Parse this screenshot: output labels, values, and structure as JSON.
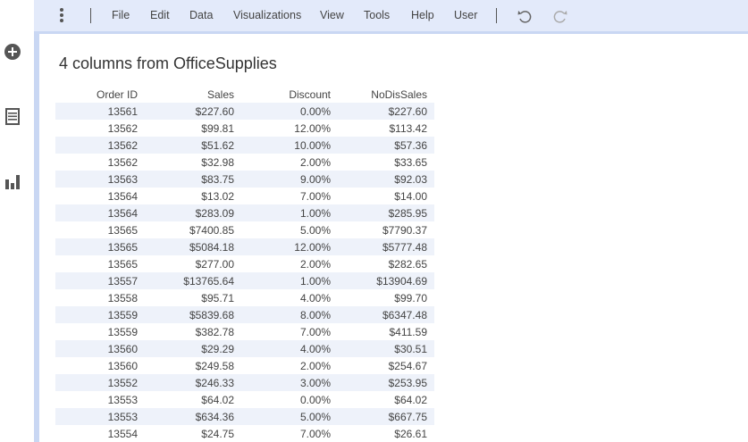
{
  "toolbar": {
    "menus": [
      "File",
      "Edit",
      "Data",
      "Visualizations",
      "View",
      "Tools",
      "Help",
      "User"
    ],
    "icons": [
      "more-vert-icon",
      "undo-icon",
      "redo-icon"
    ]
  },
  "left_rail": {
    "icons": [
      "add-circle-icon",
      "data-table-icon",
      "bar-chart-icon"
    ]
  },
  "main": {
    "title": "4 columns from OfficeSupplies",
    "columns": [
      "Order ID",
      "Sales",
      "Discount",
      "NoDisSales"
    ],
    "rows": [
      [
        "13561",
        "$227.60",
        "0.00%",
        "$227.60"
      ],
      [
        "13562",
        "$99.81",
        "12.00%",
        "$113.42"
      ],
      [
        "13562",
        "$51.62",
        "10.00%",
        "$57.36"
      ],
      [
        "13562",
        "$32.98",
        "2.00%",
        "$33.65"
      ],
      [
        "13563",
        "$83.75",
        "9.00%",
        "$92.03"
      ],
      [
        "13564",
        "$13.02",
        "7.00%",
        "$14.00"
      ],
      [
        "13564",
        "$283.09",
        "1.00%",
        "$285.95"
      ],
      [
        "13565",
        "$7400.85",
        "5.00%",
        "$7790.37"
      ],
      [
        "13565",
        "$5084.18",
        "12.00%",
        "$5777.48"
      ],
      [
        "13565",
        "$277.00",
        "2.00%",
        "$282.65"
      ],
      [
        "13557",
        "$13765.64",
        "1.00%",
        "$13904.69"
      ],
      [
        "13558",
        "$95.71",
        "4.00%",
        "$99.70"
      ],
      [
        "13559",
        "$5839.68",
        "8.00%",
        "$6347.48"
      ],
      [
        "13559",
        "$382.78",
        "7.00%",
        "$411.59"
      ],
      [
        "13560",
        "$29.29",
        "4.00%",
        "$30.51"
      ],
      [
        "13560",
        "$249.58",
        "2.00%",
        "$254.67"
      ],
      [
        "13552",
        "$246.33",
        "3.00%",
        "$253.95"
      ],
      [
        "13553",
        "$64.02",
        "0.00%",
        "$64.02"
      ],
      [
        "13553",
        "$634.36",
        "5.00%",
        "$667.75"
      ],
      [
        "13554",
        "$24.75",
        "7.00%",
        "$26.61"
      ]
    ]
  },
  "colors": {
    "toolbar_bg": "#e3eafa",
    "accent_strip": "#c9d7f3",
    "row_shade": "#eef2fa",
    "icon_gray": "#555555"
  }
}
